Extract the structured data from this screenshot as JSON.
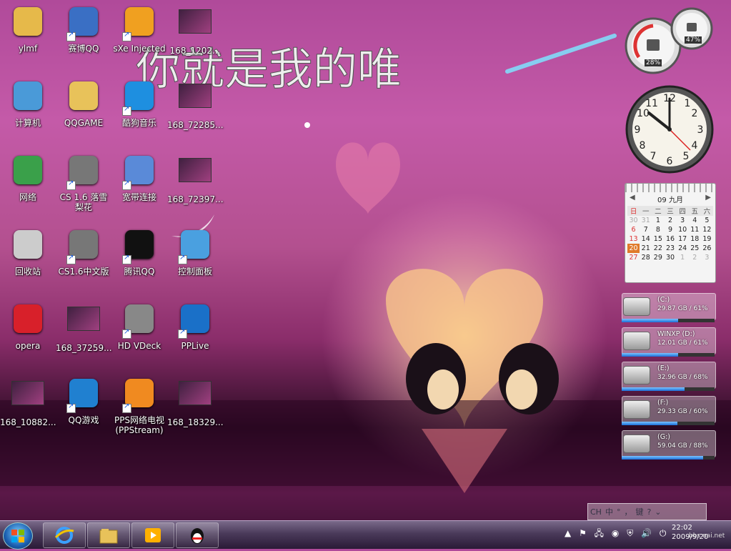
{
  "wallpaper": {
    "title_text": "你就是我的唯"
  },
  "desktop_icons": [
    {
      "label": "ylmf",
      "icon": "folder-user-icon"
    },
    {
      "label": "赛博QQ",
      "icon": "saibo-qq-icon"
    },
    {
      "label": "sXe Injected",
      "icon": "sxe-injected-icon"
    },
    {
      "label": "168_1202...",
      "icon": "image-file-icon"
    },
    {
      "label": "计算机",
      "icon": "computer-icon"
    },
    {
      "label": "QQGAME",
      "icon": "folder-icon"
    },
    {
      "label": "酷狗音乐",
      "icon": "kugou-music-icon"
    },
    {
      "label": "168_72285...",
      "icon": "image-file-icon"
    },
    {
      "label": "网络",
      "icon": "network-icon"
    },
    {
      "label": "CS 1.6 落雪梨花",
      "icon": "counter-strike-icon"
    },
    {
      "label": "宽带连接",
      "icon": "broadband-connection-icon"
    },
    {
      "label": "168_72397...",
      "icon": "image-file-icon"
    },
    {
      "label": "回收站",
      "icon": "recycle-bin-icon"
    },
    {
      "label": "CS1.6中文版",
      "icon": "counter-strike-icon"
    },
    {
      "label": "腾讯QQ",
      "icon": "tencent-qq-icon"
    },
    {
      "label": "控制面板",
      "icon": "control-panel-icon"
    },
    {
      "label": "opera",
      "icon": "opera-icon"
    },
    {
      "label": "168_37259...",
      "icon": "image-file-icon"
    },
    {
      "label": "HD VDeck",
      "icon": "hd-vdeck-icon"
    },
    {
      "label": "PPLive",
      "icon": "pplive-icon"
    },
    {
      "label": "168_10882...",
      "icon": "image-file-icon"
    },
    {
      "label": "QQ游戏",
      "icon": "qq-game-icon"
    },
    {
      "label": "PPS网络电视 (PPStream)",
      "icon": "pps-icon"
    },
    {
      "label": "168_18329...",
      "icon": "image-file-icon"
    }
  ],
  "gadgets": {
    "cpu_meter": {
      "cpu_percent": "28%",
      "memory_percent": "47%"
    },
    "calendar": {
      "header": "09 九月",
      "weekdays": [
        "日",
        "一",
        "二",
        "三",
        "四",
        "五",
        "六"
      ],
      "weeks": [
        [
          "30",
          "31",
          "1",
          "2",
          "3",
          "4",
          "5"
        ],
        [
          "6",
          "7",
          "8",
          "9",
          "10",
          "11",
          "12"
        ],
        [
          "13",
          "14",
          "15",
          "16",
          "17",
          "18",
          "19"
        ],
        [
          "20",
          "21",
          "22",
          "23",
          "24",
          "25",
          "26"
        ],
        [
          "27",
          "28",
          "29",
          "30",
          "1",
          "2",
          "3"
        ]
      ],
      "today": "20"
    },
    "drives": [
      {
        "name": "(C:)",
        "info": "29.87 GB / 61%",
        "fill_percent": 61
      },
      {
        "name": "WINXP (D:)",
        "info": "12.01 GB / 61%",
        "fill_percent": 61
      },
      {
        "name": "(E:)",
        "info": "32.96 GB / 68%",
        "fill_percent": 68
      },
      {
        "name": "(F:)",
        "info": "29.33 GB / 60%",
        "fill_percent": 60
      },
      {
        "name": "(G:)",
        "info": "59.04 GB / 88%",
        "fill_percent": 88
      }
    ]
  },
  "language_bar": {
    "items": [
      "CH",
      "中",
      "°",
      "，",
      "键",
      "?",
      "⌄"
    ]
  },
  "taskbar": {
    "pinned": [
      {
        "name": "internet-explorer-icon"
      },
      {
        "name": "windows-explorer-icon"
      },
      {
        "name": "media-player-icon"
      },
      {
        "name": "qq-penguin-icon"
      }
    ],
    "clock_line1": "22:02",
    "clock_line2": "2009/9/20",
    "watermark": "bbs.nai.net"
  },
  "colors": {
    "taskbar": "#4a3a5a",
    "calendar_today": "#e07a2a",
    "drive_fill": "#1a6fd8"
  }
}
